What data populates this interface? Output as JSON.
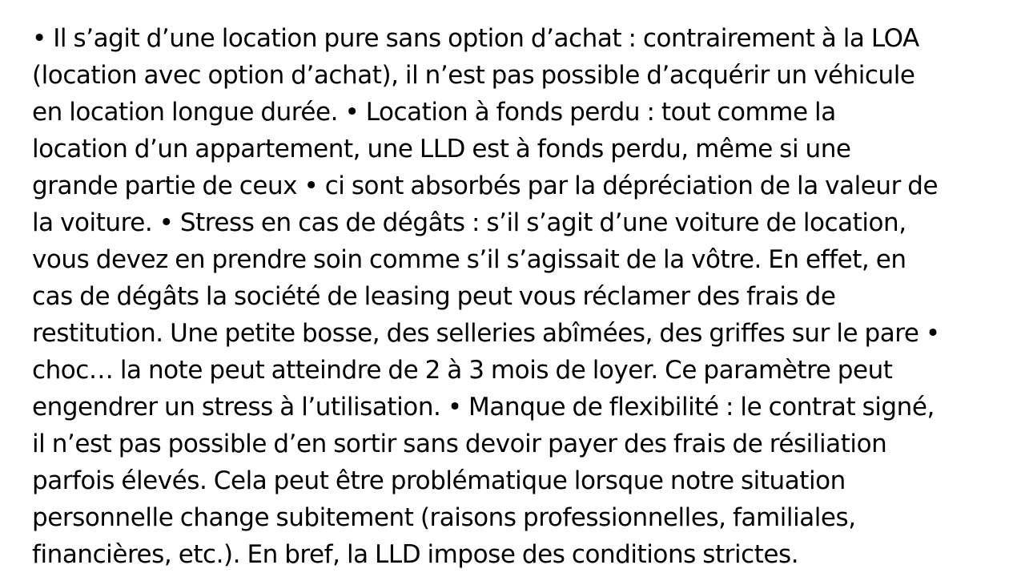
{
  "document": {
    "lines": [
      "• Il s’agit d’une location pure sans option d’achat : contrairement à la LOA",
      "(location avec option d’achat), il n’est pas possible d’acquérir un véhicule",
      "en location longue durée. • Location à fonds perdu : tout comme la",
      "location d’un appartement, une LLD est à fonds perdu, même si une",
      "grande partie de ceux • ci sont absorbés par la dépréciation de la valeur de",
      "la voiture. • Stress en cas de dégâts : s’il s’agit d’une voiture de location,",
      "vous devez en prendre soin comme s’il s’agissait de la vôtre. En effet, en",
      "cas de dégâts la société de leasing peut vous réclamer des frais de",
      "restitution. Une petite bosse, des selleries abîmées, des griffes sur le pare •",
      "choc… la note peut atteindre de 2 à 3 mois de loyer. Ce paramètre peut",
      "engendrer un stress à l’utilisation. • Manque de flexibilité : le contrat signé,",
      "il n’est pas possible d’en sortir sans devoir payer des frais de résiliation",
      "parfois élevés. Cela peut être problématique lorsque notre situation",
      "personnelle change subitement (raisons professionnelles, familiales,",
      "financières, etc.). En bref, la LLD impose des conditions strictes."
    ]
  }
}
